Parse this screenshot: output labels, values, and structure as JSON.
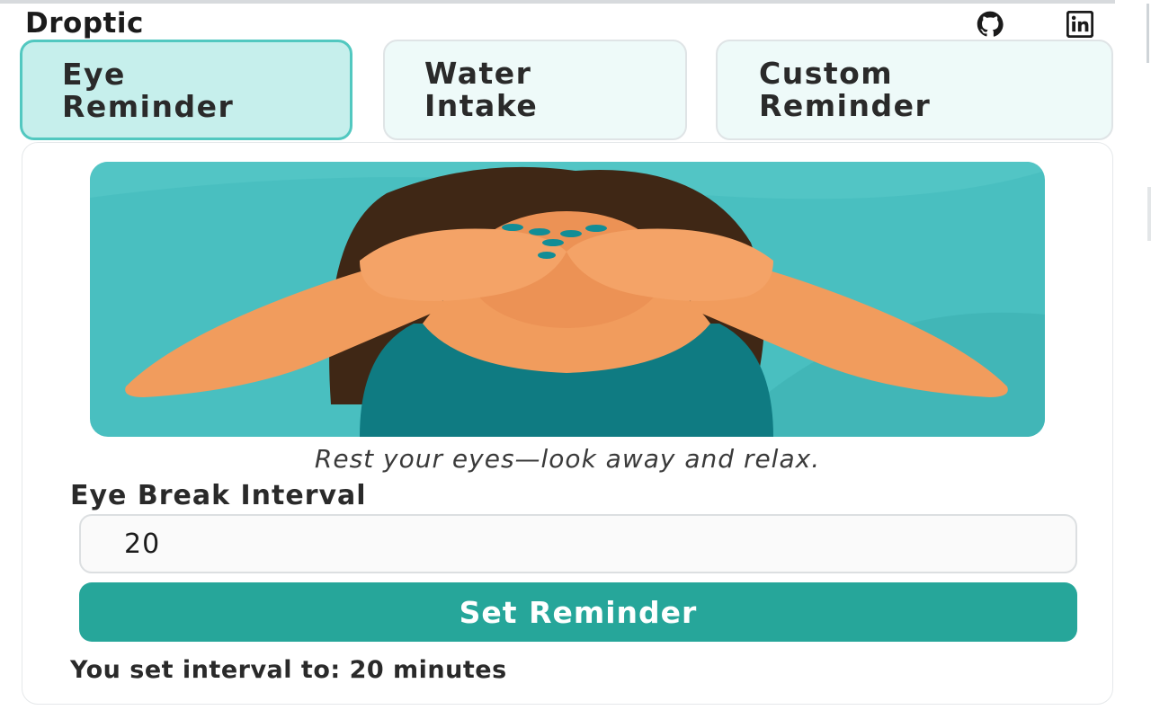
{
  "app": {
    "title": "Droptic"
  },
  "header": {
    "github_icon": "github-icon",
    "linkedin_icon": "linkedin-icon"
  },
  "tabs": [
    {
      "label": "Eye\nReminder",
      "active": true
    },
    {
      "label": "Water\nIntake",
      "active": false
    },
    {
      "label": "Custom\nReminder",
      "active": false
    }
  ],
  "main": {
    "illustration_icon": "eye-rest-illustration",
    "caption": "Rest your eyes—look away and relax.",
    "interval_label": "Eye Break Interval",
    "interval_value": "20",
    "button_label": "Set Reminder",
    "status_text": "You set interval to: 20 minutes"
  },
  "colors": {
    "accent": "#26a69a",
    "active_tab_bg": "#c6efec",
    "active_tab_border": "#52c8c0",
    "illustration_bg": "#49bfc0"
  }
}
